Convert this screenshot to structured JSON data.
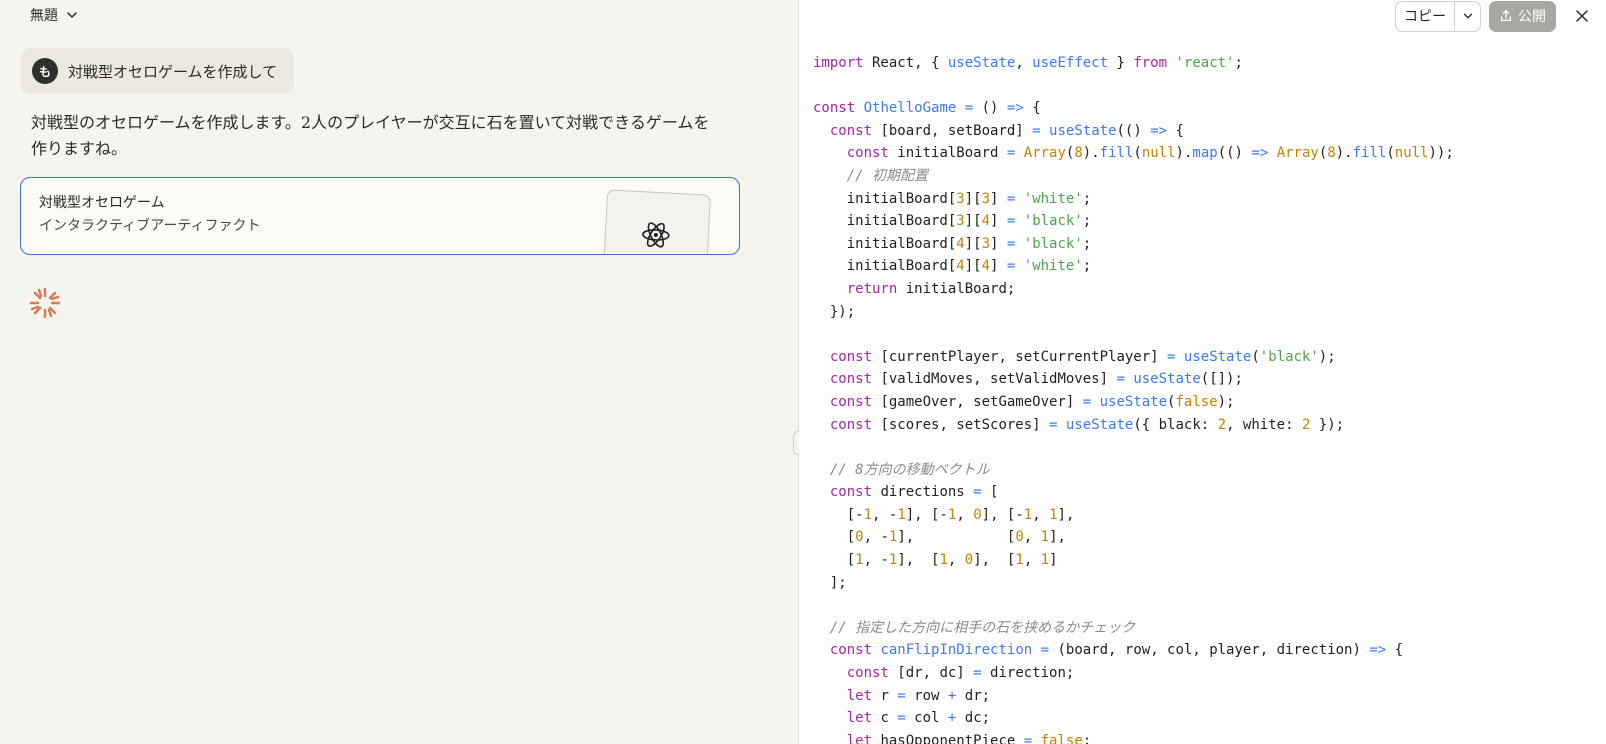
{
  "conversation": {
    "title": "無題",
    "user": {
      "avatar_initial": "も",
      "message": "対戦型オセロゲームを作成して"
    },
    "assistant": {
      "text": "対戦型のオセロゲームを作成します。2人のプレイヤーが交互に石を置いて対戦できるゲームを作りますね。"
    },
    "artifact": {
      "title": "対戦型オセロゲーム",
      "subtitle": "インタラクティブアーティファクト",
      "icon": "atom-icon"
    },
    "spinner_icon": "loading-spinner-icon"
  },
  "toolbar": {
    "copy_label": "コピー",
    "publish_label": "公開",
    "close_icon": "close-icon"
  },
  "code": {
    "language": "jsx",
    "lines": [
      "import React, { useState, useEffect } from 'react';",
      "",
      "const OthelloGame = () => {",
      "  const [board, setBoard] = useState(() => {",
      "    const initialBoard = Array(8).fill(null).map(() => Array(8).fill(null));",
      "    // 初期配置",
      "    initialBoard[3][3] = 'white';",
      "    initialBoard[3][4] = 'black';",
      "    initialBoard[4][3] = 'black';",
      "    initialBoard[4][4] = 'white';",
      "    return initialBoard;",
      "  });",
      "",
      "  const [currentPlayer, setCurrentPlayer] = useState('black');",
      "  const [validMoves, setValidMoves] = useState([]);",
      "  const [gameOver, setGameOver] = useState(false);",
      "  const [scores, setScores] = useState({ black: 2, white: 2 });",
      "",
      "  // 8方向の移動ベクトル",
      "  const directions = [",
      "    [-1, -1], [-1, 0], [-1, 1],",
      "    [0, -1],           [0, 1],",
      "    [1, -1],  [1, 0],  [1, 1]",
      "  ];",
      "",
      "  // 指定した方向に相手の石を挟めるかチェック",
      "  const canFlipInDirection = (board, row, col, player, direction) => {",
      "    const [dr, dc] = direction;",
      "    let r = row + dr;",
      "    let c = col + dc;",
      "    let hasOpponentPiece = false;"
    ]
  }
}
